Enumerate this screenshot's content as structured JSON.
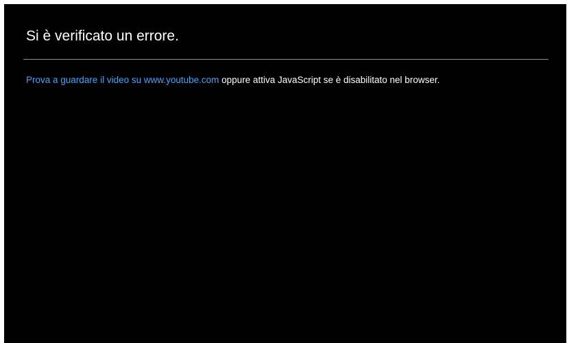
{
  "error": {
    "title": "Si è verificato un errore.",
    "link_text": "Prova a guardare il video su www.youtube.com",
    "message_rest": " oppure attiva JavaScript se è disabilitato nel browser."
  },
  "colors": {
    "background": "#000000",
    "text": "#ffffff",
    "link": "#3ea6ff",
    "divider": "#8e8e8e"
  }
}
